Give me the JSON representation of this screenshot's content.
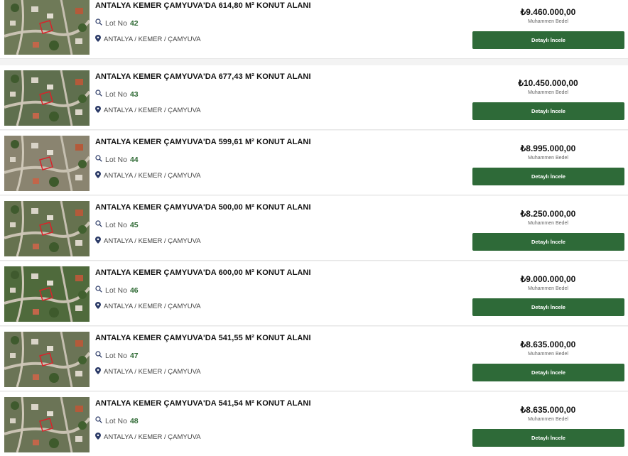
{
  "listings": [
    {
      "title": "ANTALYA KEMER ÇAMYUVA'DA 614,80 M² KONUT ALANI",
      "lot_label": "Lot No",
      "lot_no": "42",
      "location": "ANTALYA / KEMER / ÇAMYUVA",
      "price": "₺9.460.000,00",
      "price_label": "Muhammen Bedel",
      "button_label": "Detaylı İncele",
      "thumb_tone": "#6f7a58"
    },
    {
      "title": "ANTALYA KEMER ÇAMYUVA'DA 677,43 M² KONUT ALANI",
      "lot_label": "Lot No",
      "lot_no": "43",
      "location": "ANTALYA / KEMER / ÇAMYUVA",
      "price": "₺10.450.000,00",
      "price_label": "Muhammen Bedel",
      "button_label": "Detaylı İncele",
      "thumb_tone": "#5f6f4e"
    },
    {
      "title": "ANTALYA KEMER ÇAMYUVA'DA 599,61 M² KONUT ALANI",
      "lot_label": "Lot No",
      "lot_no": "44",
      "location": "ANTALYA / KEMER / ÇAMYUVA",
      "price": "₺8.995.000,00",
      "price_label": "Muhammen Bedel",
      "button_label": "Detaylı İncele",
      "thumb_tone": "#8a8470"
    },
    {
      "title": "ANTALYA KEMER ÇAMYUVA'DA 500,00 M² KONUT ALANI",
      "lot_label": "Lot No",
      "lot_no": "45",
      "location": "ANTALYA / KEMER / ÇAMYUVA",
      "price": "₺8.250.000,00",
      "price_label": "Muhammen Bedel",
      "button_label": "Detaylı İncele",
      "thumb_tone": "#66724f"
    },
    {
      "title": "ANTALYA KEMER ÇAMYUVA'DA 600,00 M² KONUT ALANI",
      "lot_label": "Lot No",
      "lot_no": "46",
      "location": "ANTALYA / KEMER / ÇAMYUVA",
      "price": "₺9.000.000,00",
      "price_label": "Muhammen Bedel",
      "button_label": "Detaylı İncele",
      "thumb_tone": "#4f6a3c"
    },
    {
      "title": "ANTALYA KEMER ÇAMYUVA'DA 541,55 M² KONUT ALANI",
      "lot_label": "Lot No",
      "lot_no": "47",
      "location": "ANTALYA / KEMER / ÇAMYUVA",
      "price": "₺8.635.000,00",
      "price_label": "Muhammen Bedel",
      "button_label": "Detaylı İncele",
      "thumb_tone": "#6b7456"
    },
    {
      "title": "ANTALYA KEMER ÇAMYUVA'DA 541,54 M² KONUT ALANI",
      "lot_label": "Lot No",
      "lot_no": "48",
      "location": "ANTALYA / KEMER / ÇAMYUVA",
      "price": "₺8.635.000,00",
      "price_label": "Muhammen Bedel",
      "button_label": "Detaylı İncele",
      "thumb_tone": "#6b7456"
    }
  ],
  "colors": {
    "button_bg": "#2e6a38",
    "lot_number": "#2f6a35",
    "icon": "#2b3a67",
    "plot_marker": "#d8232a"
  },
  "icons": {
    "lot": "search-icon",
    "location": "map-pin-icon"
  }
}
